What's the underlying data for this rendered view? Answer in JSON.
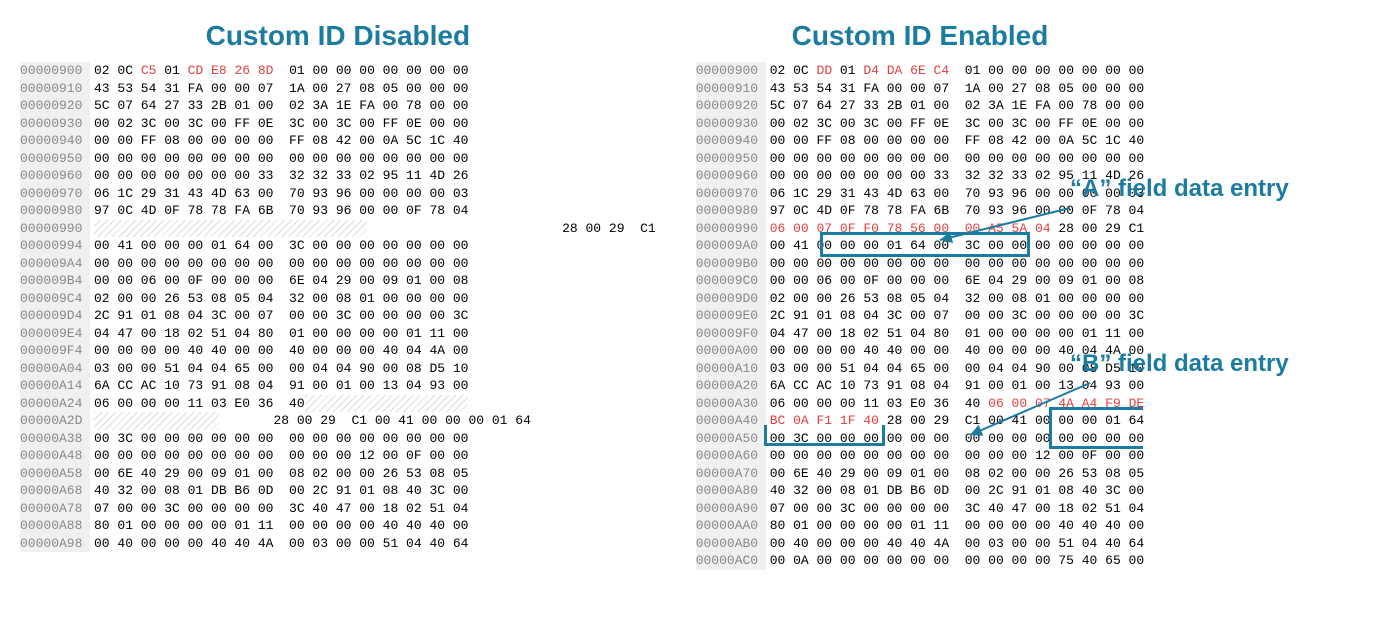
{
  "titles": {
    "left": "Custom ID Disabled",
    "right": "Custom ID Enabled"
  },
  "annotations": {
    "a": "“A” field data entry",
    "b": "“B” field data entry"
  },
  "left_rows": [
    {
      "off": "00000900",
      "bytes": [
        [
          "02 0C ",
          ""
        ],
        [
          "C5",
          "r"
        ],
        [
          " 01 ",
          ""
        ],
        [
          "CD E8 26 8D",
          "r"
        ],
        [
          "  01 00 00 00 00 00 00 00",
          ""
        ]
      ]
    },
    {
      "off": "00000910",
      "bytes": [
        [
          "43 53 54 31 FA 00 00 07  1A 00 27 08 05 00 00 00",
          ""
        ]
      ]
    },
    {
      "off": "00000920",
      "bytes": [
        [
          "5C 07 64 27 33 2B 01 00  02 3A 1E FA 00 78 00 00",
          ""
        ]
      ]
    },
    {
      "off": "00000930",
      "bytes": [
        [
          "00 02 3C 00 3C 00 FF 0E  3C 00 3C 00 FF 0E 00 00",
          ""
        ]
      ]
    },
    {
      "off": "00000940",
      "bytes": [
        [
          "00 00 FF 08 00 00 00 00  FF 08 42 00 0A 5C 1C 40",
          ""
        ]
      ]
    },
    {
      "off": "00000950",
      "bytes": [
        [
          "00 00 00 00 00 00 00 00  00 00 00 00 00 00 00 00",
          ""
        ]
      ]
    },
    {
      "off": "00000960",
      "bytes": [
        [
          "00 00 00 00 00 00 00 33  32 32 33 02 95 11 4D 26",
          ""
        ]
      ]
    },
    {
      "off": "00000970",
      "bytes": [
        [
          "06 1C 29 31 43 4D 63 00  70 93 96 00 00 00 00 03",
          ""
        ]
      ]
    },
    {
      "off": "00000980",
      "bytes": [
        [
          "97 0C 4D 0F 78 78 FA 6B  70 93 96 00 00 0F 78 04",
          ""
        ]
      ]
    },
    {
      "off": "00000990",
      "bytes": [
        [
          "",
          "hatch-wide"
        ],
        [
          "                         28 00 29  C1",
          ""
        ]
      ]
    },
    {
      "off": "00000994",
      "bytes": [
        [
          "00 41 00 00 00 01 64 00  3C 00 00 00 00 00 00 00",
          ""
        ]
      ]
    },
    {
      "off": "000009A4",
      "bytes": [
        [
          "00 00 00 00 00 00 00 00  00 00 00 00 00 00 00 00",
          ""
        ]
      ]
    },
    {
      "off": "000009B4",
      "bytes": [
        [
          "00 00 06 00 0F 00 00 00  6E 04 29 00 09 01 00 08",
          ""
        ]
      ]
    },
    {
      "off": "000009C4",
      "bytes": [
        [
          "02 00 00 26 53 08 05 04  32 00 08 01 00 00 00 00",
          ""
        ]
      ]
    },
    {
      "off": "000009D4",
      "bytes": [
        [
          "2C 91 01 08 04 3C 00 07  00 00 3C 00 00 00 00 3C",
          ""
        ]
      ]
    },
    {
      "off": "000009E4",
      "bytes": [
        [
          "04 47 00 18 02 51 04 80  01 00 00 00 00 01 11 00",
          ""
        ]
      ]
    },
    {
      "off": "000009F4",
      "bytes": [
        [
          "00 00 00 00 40 40 00 00  40 00 00 00 40 04 4A 00",
          ""
        ]
      ]
    },
    {
      "off": "00000A04",
      "bytes": [
        [
          "03 00 00 51 04 04 65 00  00 04 04 90 00 08 D5 10",
          ""
        ]
      ]
    },
    {
      "off": "00000A14",
      "bytes": [
        [
          "6A CC AC 10 73 91 08 04  91 00 01 00 13 04 93 00",
          ""
        ]
      ]
    },
    {
      "off": "00000A24",
      "bytes": [
        [
          "06 00 00 00 11 03 E0 36  40",
          ""
        ],
        [
          "",
          "hatch-short"
        ]
      ]
    },
    {
      "off": "00000A2D",
      "bytes": [
        [
          "",
          "hatch-wide2"
        ],
        [
          "       28 00 29  C1 00 41 00 00 00 01 64",
          ""
        ]
      ]
    },
    {
      "off": "00000A38",
      "bytes": [
        [
          "00 3C 00 00 00 00 00 00  00 00 00 00 00 00 00 00",
          ""
        ]
      ]
    },
    {
      "off": "00000A48",
      "bytes": [
        [
          "00 00 00 00 00 00 00 00  00 00 00 12 00 0F 00 00",
          ""
        ]
      ]
    },
    {
      "off": "00000A58",
      "bytes": [
        [
          "00 6E 40 29 00 09 01 00  08 02 00 00 26 53 08 05",
          ""
        ]
      ]
    },
    {
      "off": "00000A68",
      "bytes": [
        [
          "40 32 00 08 01 DB B6 0D  00 2C 91 01 08 40 3C 00",
          ""
        ]
      ]
    },
    {
      "off": "00000A78",
      "bytes": [
        [
          "07 00 00 3C 00 00 00 00  3C 40 47 00 18 02 51 04",
          ""
        ]
      ]
    },
    {
      "off": "00000A88",
      "bytes": [
        [
          "80 01 00 00 00 00 01 11  00 00 00 00 40 40 40 00",
          ""
        ]
      ]
    },
    {
      "off": "00000A98",
      "bytes": [
        [
          "00 40 00 00 00 40 40 4A  00 03 00 00 51 04 40 64",
          ""
        ]
      ]
    }
  ],
  "right_rows": [
    {
      "off": "00000900",
      "bytes": [
        [
          "02 0C ",
          ""
        ],
        [
          "DD",
          "r"
        ],
        [
          " 01 ",
          ""
        ],
        [
          "D4 DA 6E C4",
          "r"
        ],
        [
          "  01 00 00 00 00 00 00 00",
          ""
        ]
      ]
    },
    {
      "off": "00000910",
      "bytes": [
        [
          "43 53 54 31 FA 00 00 07  1A 00 27 08 05 00 00 00",
          ""
        ]
      ]
    },
    {
      "off": "00000920",
      "bytes": [
        [
          "5C 07 64 27 33 2B 01 00  02 3A 1E FA 00 78 00 00",
          ""
        ]
      ]
    },
    {
      "off": "00000930",
      "bytes": [
        [
          "00 02 3C 00 3C 00 FF 0E  3C 00 3C 00 FF 0E 00 00",
          ""
        ]
      ]
    },
    {
      "off": "00000940",
      "bytes": [
        [
          "00 00 FF 08 00 00 00 00  FF 08 42 00 0A 5C 1C 40",
          ""
        ]
      ]
    },
    {
      "off": "00000950",
      "bytes": [
        [
          "00 00 00 00 00 00 00 00  00 00 00 00 00 00 00 00",
          ""
        ]
      ]
    },
    {
      "off": "00000960",
      "bytes": [
        [
          "00 00 00 00 00 00 00 33  32 32 33 02 95 11 4D 26",
          ""
        ]
      ]
    },
    {
      "off": "00000970",
      "bytes": [
        [
          "06 1C 29 31 43 4D 63 00  70 93 96 00 00 00 00 03",
          ""
        ]
      ]
    },
    {
      "off": "00000980",
      "bytes": [
        [
          "97 0C 4D 0F 78 78 FA 6B  70 93 96 00 00 0F 78 04",
          ""
        ]
      ]
    },
    {
      "off": "00000990",
      "bytes": [
        [
          "06 00 07 0F F0 78 56 00  00 A5 5A 04",
          "r"
        ],
        [
          " 28 00 29 C1",
          ""
        ]
      ]
    },
    {
      "off": "000009A0",
      "bytes": [
        [
          "00 41 00 00 00 01 64 00  3C 00 00 00 00 00 00 00",
          ""
        ]
      ]
    },
    {
      "off": "000009B0",
      "bytes": [
        [
          "00 00 00 00 00 00 00 00  00 00 00 00 00 00 00 00",
          ""
        ]
      ]
    },
    {
      "off": "000009C0",
      "bytes": [
        [
          "00 00 06 00 0F 00 00 00  6E 04 29 00 09 01 00 08",
          ""
        ]
      ]
    },
    {
      "off": "000009D0",
      "bytes": [
        [
          "02 00 00 26 53 08 05 04  32 00 08 01 00 00 00 00",
          ""
        ]
      ]
    },
    {
      "off": "000009E0",
      "bytes": [
        [
          "2C 91 01 08 04 3C 00 07  00 00 3C 00 00 00 00 3C",
          ""
        ]
      ]
    },
    {
      "off": "000009F0",
      "bytes": [
        [
          "04 47 00 18 02 51 04 80  01 00 00 00 00 01 11 00",
          ""
        ]
      ]
    },
    {
      "off": "00000A00",
      "bytes": [
        [
          "00 00 00 00 40 40 00 00  40 00 00 00 40 04 4A 00",
          ""
        ]
      ]
    },
    {
      "off": "00000A10",
      "bytes": [
        [
          "03 00 00 51 04 04 65 00  00 04 04 90 00 08 D5 10",
          ""
        ]
      ]
    },
    {
      "off": "00000A20",
      "bytes": [
        [
          "6A CC AC 10 73 91 08 04  91 00 01 00 13 04 93 00",
          ""
        ]
      ]
    },
    {
      "off": "00000A30",
      "bytes": [
        [
          "06 00 00 00 11 03 E0 36  40 ",
          ""
        ],
        [
          "06 00 07 4A A4 F9 DE",
          "r"
        ]
      ]
    },
    {
      "off": "00000A40",
      "bytes": [
        [
          "BC 0A F1 1F 40",
          "r"
        ],
        [
          " 28 00 29  C1 00 41 00 00 00 01 64",
          ""
        ]
      ]
    },
    {
      "off": "00000A50",
      "bytes": [
        [
          "00 3C 00 00 00 00 00 00  00 00 00 00 00 00 00 00",
          ""
        ]
      ]
    },
    {
      "off": "00000A60",
      "bytes": [
        [
          "00 00 00 00 00 00 00 00  00 00 00 12 00 0F 00 00",
          ""
        ]
      ]
    },
    {
      "off": "00000A70",
      "bytes": [
        [
          "00 6E 40 29 00 09 01 00  08 02 00 00 26 53 08 05",
          ""
        ]
      ]
    },
    {
      "off": "00000A80",
      "bytes": [
        [
          "40 32 00 08 01 DB B6 0D  00 2C 91 01 08 40 3C 00",
          ""
        ]
      ]
    },
    {
      "off": "00000A90",
      "bytes": [
        [
          "07 00 00 3C 00 00 00 00  3C 40 47 00 18 02 51 04",
          ""
        ]
      ]
    },
    {
      "off": "00000AA0",
      "bytes": [
        [
          "80 01 00 00 00 00 01 11  00 00 00 00 40 40 40 00",
          ""
        ]
      ]
    },
    {
      "off": "00000AB0",
      "bytes": [
        [
          "00 40 00 00 00 40 40 4A  00 03 00 00 51 04 40 64",
          ""
        ]
      ]
    },
    {
      "off": "00000AC0",
      "bytes": [
        [
          "00 0A 00 00 00 00 00 00  00 00 00 00 75 40 65 00",
          ""
        ]
      ]
    }
  ]
}
